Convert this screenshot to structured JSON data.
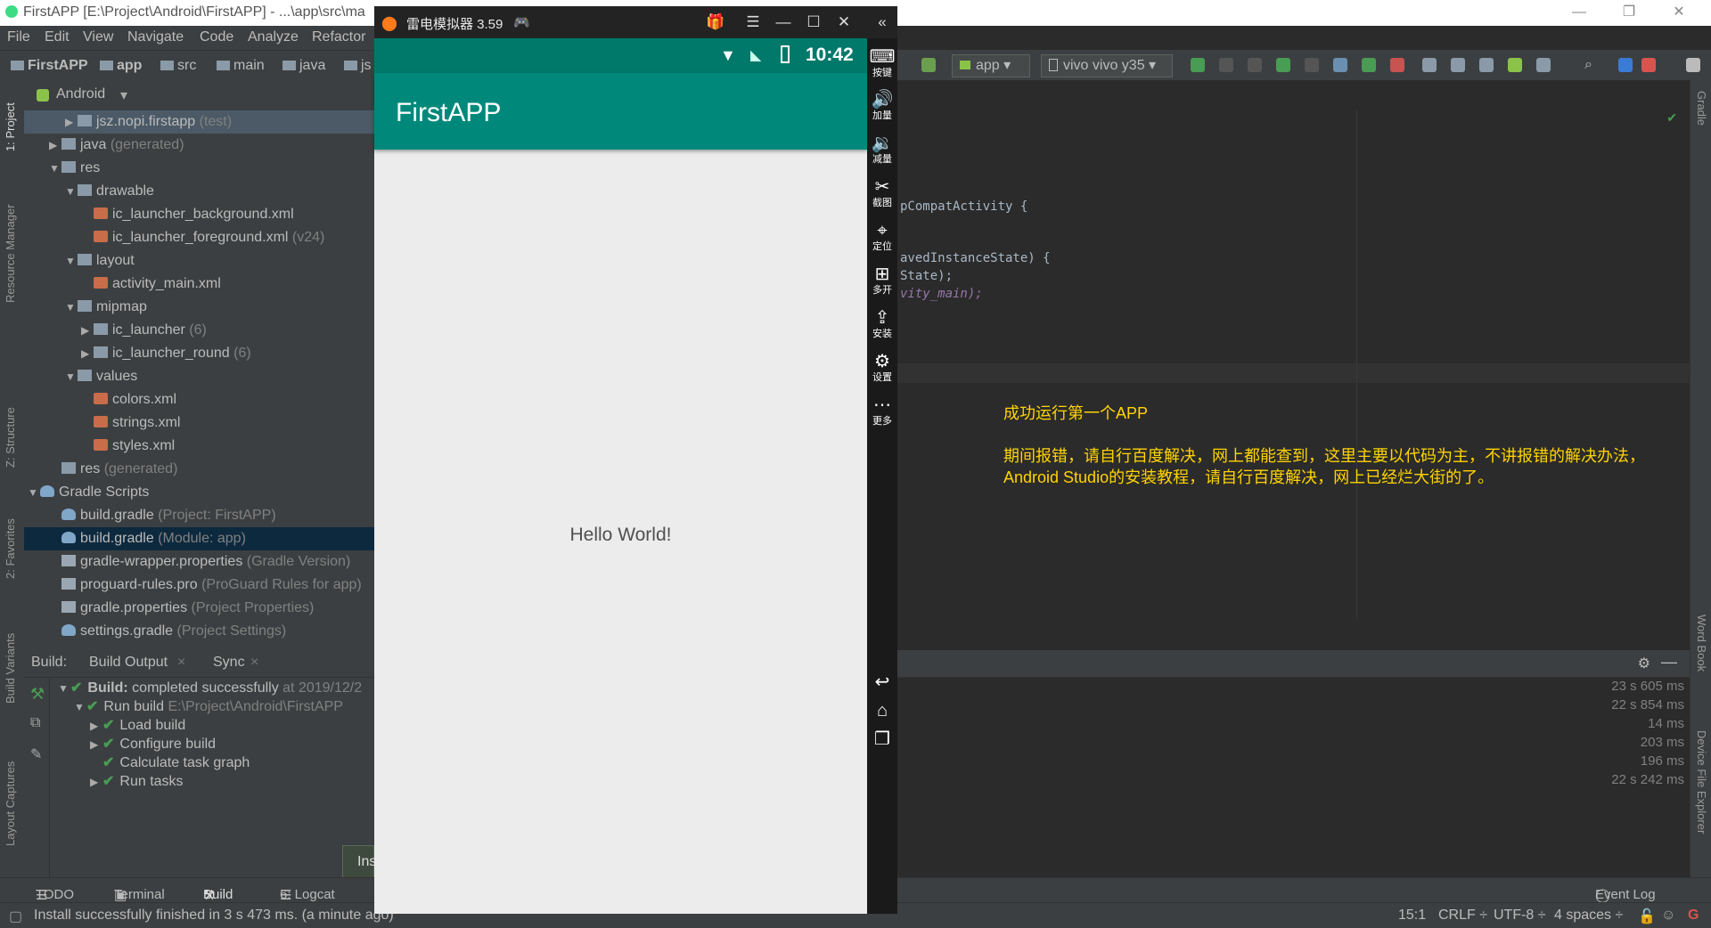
{
  "window": {
    "title": "FirstAPP [E:\\Project\\Android\\FirstAPP] - ...\\app\\src\\ma",
    "controls": [
      "—",
      "❐",
      "✕"
    ]
  },
  "menu": [
    "File",
    "Edit",
    "View",
    "Navigate",
    "Code",
    "Analyze",
    "Refactor"
  ],
  "nav": [
    "FirstAPP",
    "app",
    "src",
    "main",
    "java",
    "js"
  ],
  "left_stripe": [
    "1: Project",
    "Resource Manager",
    "Z: Structure",
    "2: Favorites",
    "Build Variants",
    "Layout Captures"
  ],
  "project": {
    "view": "Android",
    "rows": [
      {
        "label": "jsz.nopi.firstapp",
        "hint": "(test)"
      },
      {
        "label": "java",
        "hint": "(generated)"
      },
      {
        "label": "res",
        "hint": ""
      },
      {
        "label": "drawable",
        "hint": ""
      },
      {
        "label": "ic_launcher_background.xml",
        "hint": ""
      },
      {
        "label": "ic_launcher_foreground.xml",
        "hint": "(v24)"
      },
      {
        "label": "layout",
        "hint": ""
      },
      {
        "label": "activity_main.xml",
        "hint": ""
      },
      {
        "label": "mipmap",
        "hint": ""
      },
      {
        "label": "ic_launcher",
        "hint": "(6)"
      },
      {
        "label": "ic_launcher_round",
        "hint": "(6)"
      },
      {
        "label": "values",
        "hint": ""
      },
      {
        "label": "colors.xml",
        "hint": ""
      },
      {
        "label": "strings.xml",
        "hint": ""
      },
      {
        "label": "styles.xml",
        "hint": ""
      },
      {
        "label": "res",
        "hint": "(generated)"
      },
      {
        "label": "Gradle Scripts",
        "hint": ""
      },
      {
        "label": "build.gradle",
        "hint": "(Project: FirstAPP)"
      },
      {
        "label": "build.gradle",
        "hint": "(Module: app)"
      },
      {
        "label": "gradle-wrapper.properties",
        "hint": "(Gradle Version)"
      },
      {
        "label": "proguard-rules.pro",
        "hint": "(ProGuard Rules for app)"
      },
      {
        "label": "gradle.properties",
        "hint": "(Project Properties)"
      },
      {
        "label": "settings.gradle",
        "hint": "(Project Settings)"
      }
    ]
  },
  "build": {
    "label": "Build:",
    "tabs": [
      "Build Output",
      "Sync"
    ],
    "rows": [
      {
        "bold": "Build:",
        "text": " completed successfully",
        "hint": " at 2019/12/2"
      },
      {
        "bold": "",
        "text": "Run build",
        "hint": " E:\\Project\\Android\\FirstAPP"
      },
      {
        "bold": "",
        "text": "Load build",
        "hint": ""
      },
      {
        "bold": "",
        "text": "Configure build",
        "hint": ""
      },
      {
        "bold": "",
        "text": "Calculate task graph",
        "hint": ""
      },
      {
        "bold": "",
        "text": "Run tasks",
        "hint": ""
      }
    ],
    "times": [
      "23 s 605 ms",
      "22 s 854 ms",
      "14 ms",
      "203 ms",
      "196 ms",
      "22 s 242 ms"
    ],
    "tooltip": "Ins"
  },
  "toolbar": {
    "config": "app",
    "device": "vivo vivo y35"
  },
  "editor": {
    "lines": [
      "pCompatActivity {",
      "avedInstanceState) {",
      "State);",
      "vity_main);"
    ],
    "note": [
      "成功运行第一个APP",
      "",
      "期间报错，请自行百度解决，网上都能查到，这里主要以代码为主，不讲报错的解决办法，",
      "Android Studio的安装教程，请自行百度解决，网上已经烂大街的了。"
    ]
  },
  "right_stripe": [
    "Gradle",
    "Word Book",
    "Device File Explorer"
  ],
  "emulator": {
    "title": "雷电模拟器 3.59",
    "time": "10:42",
    "app_title": "FirstAPP",
    "hello": "Hello World!",
    "side": [
      {
        "icon": "keyboard-icon",
        "label": "按键"
      },
      {
        "icon": "volume-up-icon",
        "label": "加量"
      },
      {
        "icon": "volume-down-icon",
        "label": "减量"
      },
      {
        "icon": "scissors-icon",
        "label": "截图"
      },
      {
        "icon": "location-icon",
        "label": "定位"
      },
      {
        "icon": "multi-open-icon",
        "label": "多开"
      },
      {
        "icon": "apk-install-icon",
        "label": "安装"
      },
      {
        "icon": "gear-icon",
        "label": "设置"
      },
      {
        "icon": "more-icon",
        "label": "更多"
      }
    ]
  },
  "bottom_tabs": [
    "TODO",
    "Terminal",
    "Build",
    "6: Logcat"
  ],
  "event_log": "Event Log",
  "status": {
    "message": "Install successfully finished in 3 s 473 ms. (a minute ago)",
    "position": "15:1",
    "line_sep": "CRLF ÷",
    "encoding": "UTF-8 ÷",
    "indent": "4 spaces ÷"
  }
}
